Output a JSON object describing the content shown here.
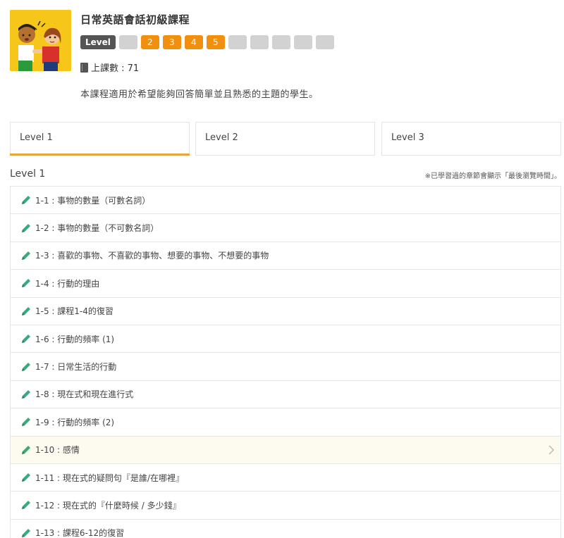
{
  "course": {
    "title": "日常英語會話初級課程",
    "level_tag": "Level",
    "level_boxes": [
      {
        "label": "",
        "active": false
      },
      {
        "label": "2",
        "active": true
      },
      {
        "label": "3",
        "active": true
      },
      {
        "label": "4",
        "active": true
      },
      {
        "label": "5",
        "active": true
      },
      {
        "label": "",
        "active": false
      },
      {
        "label": "",
        "active": false
      },
      {
        "label": "",
        "active": false
      },
      {
        "label": "",
        "active": false
      },
      {
        "label": "",
        "active": false
      }
    ],
    "lesson_count": "上課數 : 71",
    "description": "本課程適用於希望能夠回答簡單並且熟悉的主題的學生。"
  },
  "tabs": [
    {
      "label": "Level 1",
      "active": true
    },
    {
      "label": "Level 2",
      "active": false
    },
    {
      "label": "Level 3",
      "active": false
    }
  ],
  "list": {
    "title": "Level 1",
    "note": "※已學習過的章節會顯示「最後瀏覽時間」。",
    "items": [
      {
        "label": "1-1 : 事物的數量（可數名詞）"
      },
      {
        "label": "1-2 : 事物的數量（不可數名詞）"
      },
      {
        "label": "1-3 : 喜歡的事物、不喜歡的事物、想要的事物、不想要的事物"
      },
      {
        "label": "1-4 : 行動的理由"
      },
      {
        "label": "1-5 : 課程1-4的復習"
      },
      {
        "label": "1-6 : 行動的頻率 (1)"
      },
      {
        "label": "1-7 : 日常生活的行動"
      },
      {
        "label": "1-8 : 現在式和現在進行式"
      },
      {
        "label": "1-9 : 行動的頻率 (2)"
      },
      {
        "label": "1-10 : 感情"
      },
      {
        "label": "1-11 : 現在式的疑問句『是誰/在哪裡』"
      },
      {
        "label": "1-12 : 現在式的『什麼時候 / 多少錢』"
      },
      {
        "label": "1-13 : 課程6-12的復習"
      }
    ]
  },
  "colors": {
    "accent": "#f0900e",
    "tab_underline": "#e8a43a",
    "pencil": "#3aa97e",
    "thumb_bg": "#f7c61b"
  }
}
